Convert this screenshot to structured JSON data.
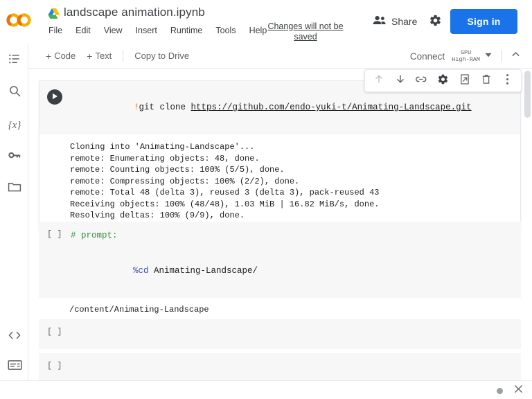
{
  "header": {
    "logo": "colab-logo",
    "drive_icon": "google-drive-icon",
    "filename": "landscape animation.ipynb",
    "menus": [
      "File",
      "Edit",
      "View",
      "Insert",
      "Runtime",
      "Tools",
      "Help"
    ],
    "unsaved_notice": "Changes will not be saved",
    "share_label": "Share",
    "share_icon": "people-icon",
    "settings_icon": "gear-icon",
    "signin_label": "Sign in",
    "accent_color": "#1a73e8"
  },
  "toolbar": {
    "add_code_label": "Code",
    "add_text_label": "Text",
    "plus_glyph": "+",
    "copy_to_drive_label": "Copy to Drive",
    "connect_label": "Connect",
    "runtime_type": "GPU",
    "runtime_ram": "High-RAM",
    "caret_icon": "chevron-down-icon",
    "collapse_icon": "chevron-up-icon"
  },
  "sidebar": {
    "items": [
      {
        "name": "table-of-contents",
        "icon": "list-icon"
      },
      {
        "name": "find-and-replace",
        "icon": "search-icon"
      },
      {
        "name": "variables",
        "icon": "variables-icon",
        "glyph": "{x}"
      },
      {
        "name": "secrets",
        "icon": "key-icon"
      },
      {
        "name": "files",
        "icon": "folder-icon"
      }
    ],
    "bottom_items": [
      {
        "name": "code-snippets",
        "icon": "code-brackets-icon"
      },
      {
        "name": "terminal",
        "icon": "terminal-icon"
      }
    ]
  },
  "cell_toolbar": {
    "buttons": [
      {
        "name": "move-cell-up",
        "icon": "arrow-up-icon",
        "disabled": true
      },
      {
        "name": "move-cell-down",
        "icon": "arrow-down-icon",
        "disabled": false
      },
      {
        "name": "link-to-cell",
        "icon": "link-icon",
        "disabled": false
      },
      {
        "name": "cell-settings",
        "icon": "gear-icon",
        "disabled": false
      },
      {
        "name": "mirror-cell-in-tab",
        "icon": "open-in-new-icon",
        "disabled": false
      },
      {
        "name": "delete-cell",
        "icon": "trash-icon",
        "disabled": false
      },
      {
        "name": "more-cell-actions",
        "icon": "more-vert-icon",
        "disabled": false
      }
    ]
  },
  "cells": [
    {
      "id": "cell-1",
      "type": "code",
      "prompt": "",
      "run_icon": "play-icon",
      "code_prefix": "!",
      "code_text": "git clone ",
      "code_url": "https://github.com/endo-yuki-t/Animating-Landscape.git",
      "output": [
        "Cloning into 'Animating-Landscape'...",
        "remote: Enumerating objects: 48, done.",
        "remote: Counting objects: 100% (5/5), done.",
        "remote: Compressing objects: 100% (2/2), done.",
        "remote: Total 48 (delta 3), reused 3 (delta 3), pack-reused 43",
        "Receiving objects: 100% (48/48), 1.03 MiB | 16.82 MiB/s, done.",
        "Resolving deltas: 100% (9/9), done."
      ]
    },
    {
      "id": "cell-2",
      "type": "code",
      "prompt": "[ ]",
      "comment_line": "# prompt:",
      "magic_token": "%cd",
      "magic_arg": " Animating-Landscape/",
      "output": [
        "/content/Animating-Landscape"
      ]
    },
    {
      "id": "cell-3",
      "type": "code",
      "prompt": "[ ]"
    },
    {
      "id": "cell-4",
      "type": "code",
      "prompt": "[ ]"
    }
  ],
  "footer": {
    "status_dot": "status-dot",
    "close_icon": "close-icon"
  }
}
